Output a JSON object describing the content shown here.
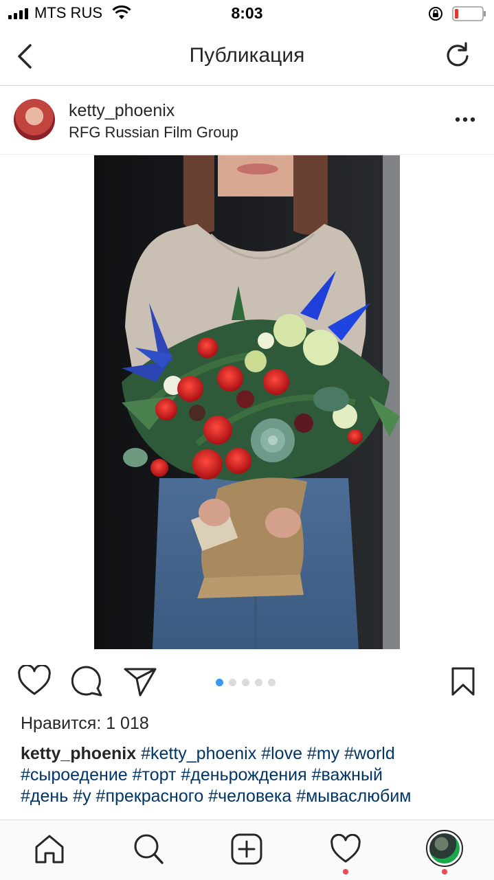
{
  "status_bar": {
    "carrier": "MTS RUS",
    "time": "8:03"
  },
  "nav": {
    "title": "Публикация"
  },
  "post": {
    "username": "ketty_phoenix",
    "location": "RFG Russian Film Group",
    "carousel": {
      "count": 5,
      "active_index": 0
    },
    "likes_text": "Нравится: 1 018",
    "caption": {
      "username": "ketty_phoenix",
      "hashtags": [
        "#ketty_phoenix",
        "#love",
        "#my",
        "#world",
        "#сыроедение",
        "#торт",
        "#деньрождения",
        "#важный",
        "#день",
        "#у",
        "#прекрасного",
        "#человека",
        "#мываслюбим"
      ]
    }
  },
  "tabbar": {
    "items": [
      "home-icon",
      "search-icon",
      "add-icon",
      "heart-icon",
      "profile-avatar"
    ]
  },
  "colors": {
    "accent": "#3897f0",
    "hashtag": "#003569",
    "notification": "#ed4956",
    "battery_low": "#e0382f"
  }
}
